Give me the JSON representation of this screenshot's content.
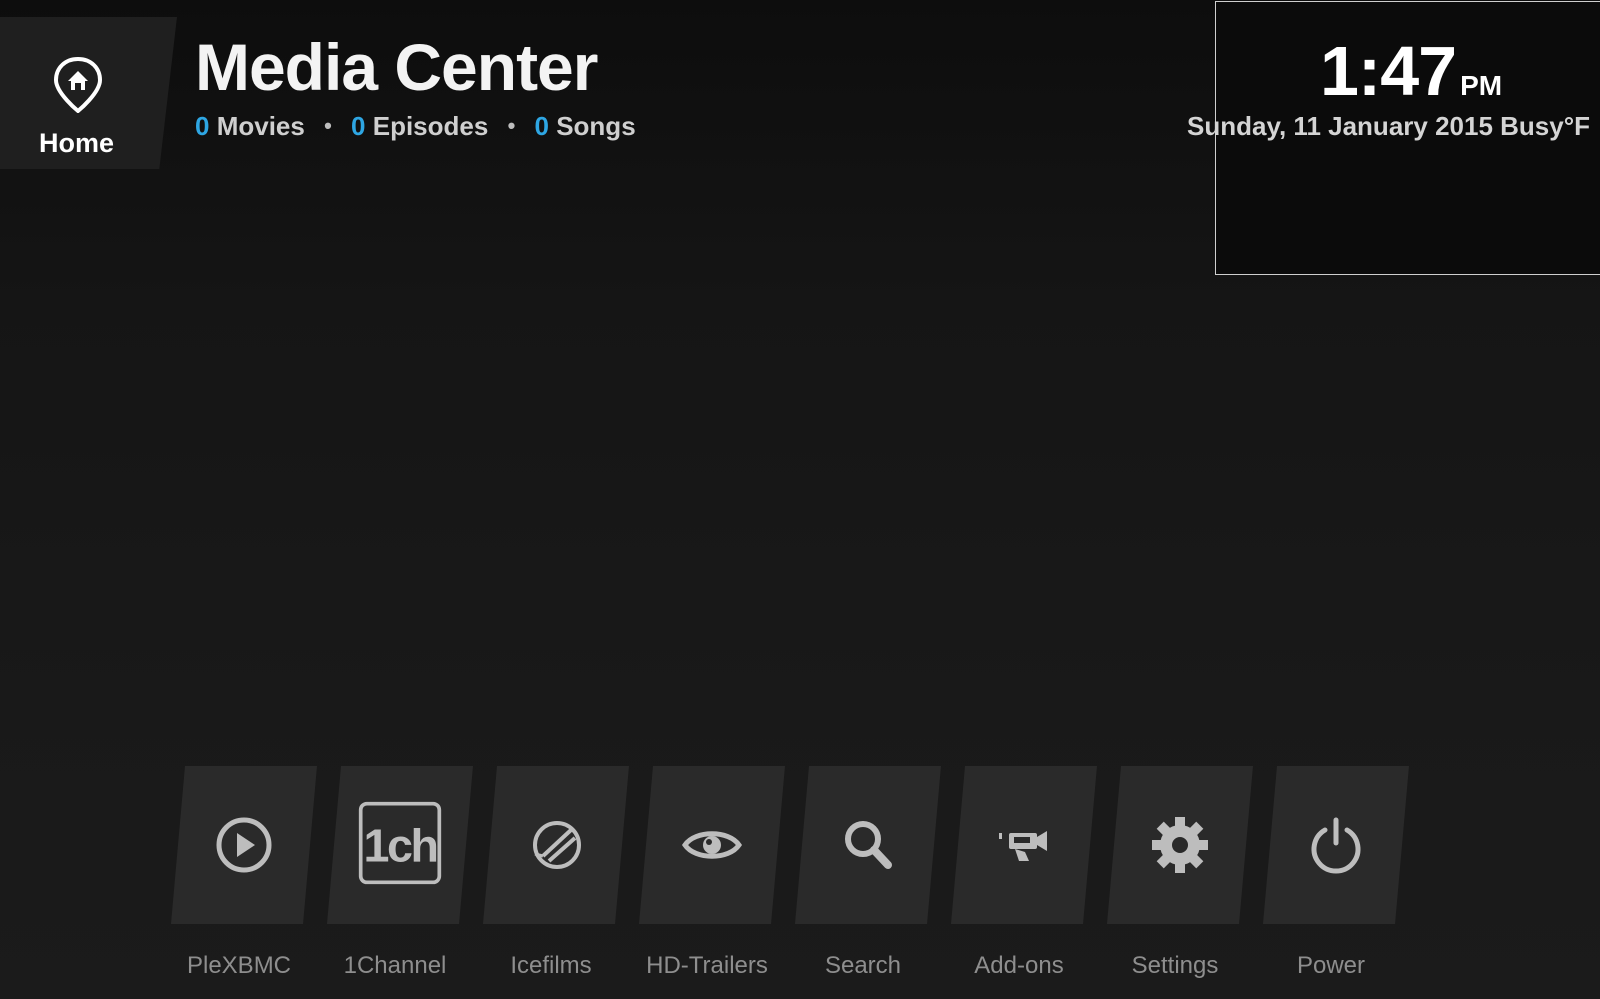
{
  "header": {
    "home_label": "Home",
    "title": "Media Center",
    "stats": {
      "movies_count": "0",
      "movies_label": "Movies",
      "episodes_count": "0",
      "episodes_label": "Episodes",
      "songs_count": "0",
      "songs_label": "Songs",
      "separator": "•"
    }
  },
  "clock": {
    "time": "1:47",
    "ampm": "PM",
    "date_line": "Sunday, 11 January 2015 Busy°F"
  },
  "menu": {
    "items": [
      {
        "label": "PleXBMC",
        "icon": "play-circle-icon"
      },
      {
        "label": "1Channel",
        "icon": "1ch-logo-icon"
      },
      {
        "label": "Icefilms",
        "icon": "icefilms-globe-icon"
      },
      {
        "label": "HD-Trailers",
        "icon": "eye-icon"
      },
      {
        "label": "Search",
        "icon": "search-icon"
      },
      {
        "label": "Add-ons",
        "icon": "projector-icon"
      },
      {
        "label": "Settings",
        "icon": "gear-icon"
      },
      {
        "label": "Power",
        "icon": "power-icon"
      }
    ]
  },
  "colors": {
    "accent": "#2ea6e3",
    "tile": "#2a2a2a",
    "icon": "#bdbdbd",
    "label": "#8e8e8e"
  }
}
